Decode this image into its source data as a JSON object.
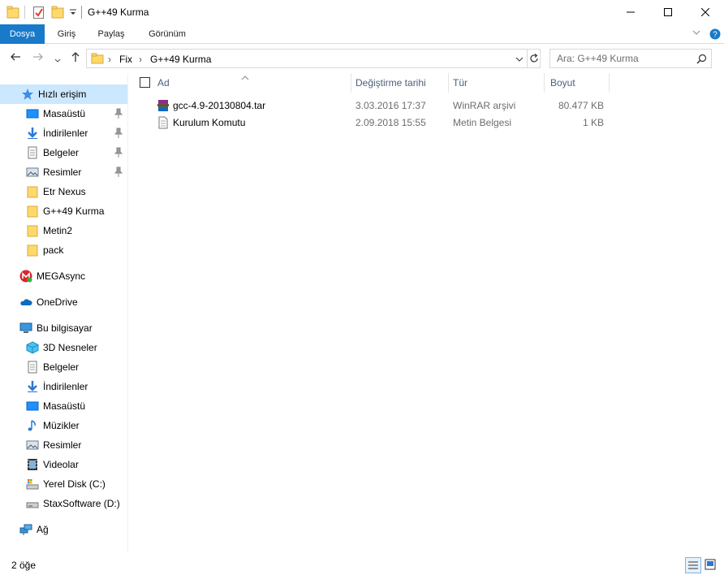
{
  "window": {
    "title": "G++49 Kurma",
    "minimize_glyph": "—",
    "maximize_glyph": "☐",
    "close_glyph": "✕"
  },
  "ribbon": {
    "tabs": [
      {
        "label": "Dosya"
      },
      {
        "label": "Giriş"
      },
      {
        "label": "Paylaş"
      },
      {
        "label": "Görünüm"
      }
    ]
  },
  "address": {
    "breadcrumbs": [
      {
        "label": "Fix"
      },
      {
        "label": "G++49 Kurma"
      }
    ],
    "search_placeholder": "Ara: G++49 Kurma"
  },
  "nav": {
    "quick_access": "Hızlı erişim",
    "pinned": [
      {
        "label": "Masaüstü",
        "icon": "desktop-icon"
      },
      {
        "label": "İndirilenler",
        "icon": "download-icon"
      },
      {
        "label": "Belgeler",
        "icon": "documents-icon"
      },
      {
        "label": "Resimler",
        "icon": "pictures-icon"
      }
    ],
    "recent": [
      {
        "label": "Etr Nexus"
      },
      {
        "label": "G++49 Kurma"
      },
      {
        "label": "Metin2"
      },
      {
        "label": "pack"
      }
    ],
    "megasync": "MEGAsync",
    "onedrive": "OneDrive",
    "this_pc": "Bu bilgisayar",
    "pc_items": [
      {
        "label": "3D Nesneler",
        "icon": "3d-objects-icon"
      },
      {
        "label": "Belgeler",
        "icon": "documents-icon"
      },
      {
        "label": "İndirilenler",
        "icon": "download-icon"
      },
      {
        "label": "Masaüstü",
        "icon": "desktop-icon"
      },
      {
        "label": "Müzikler",
        "icon": "music-icon"
      },
      {
        "label": "Resimler",
        "icon": "pictures-icon"
      },
      {
        "label": "Videolar",
        "icon": "videos-icon"
      },
      {
        "label": "Yerel Disk (C:)",
        "icon": "local-disk-icon"
      },
      {
        "label": "StaxSoftware (D:)",
        "icon": "drive-icon"
      }
    ],
    "network": "Ağ"
  },
  "columns": {
    "name": "Ad",
    "modified": "Değiştirme tarihi",
    "type": "Tür",
    "size": "Boyut"
  },
  "files": [
    {
      "name": "gcc-4.9-20130804.tar",
      "modified": "3.03.2016 17:37",
      "type": "WinRAR arşivi",
      "size": "80.477 KB",
      "icon": "winrar-archive-icon"
    },
    {
      "name": "Kurulum Komutu",
      "modified": "2.09.2018 15:55",
      "type": "Metin Belgesi",
      "size": "1 KB",
      "icon": "text-document-icon"
    }
  ],
  "status": {
    "item_count": "2 öğe"
  },
  "colors": {
    "accent": "#1979ca",
    "selected": "#cce8ff",
    "header_text": "#4c607a",
    "meta_text": "#6d6d6d"
  }
}
